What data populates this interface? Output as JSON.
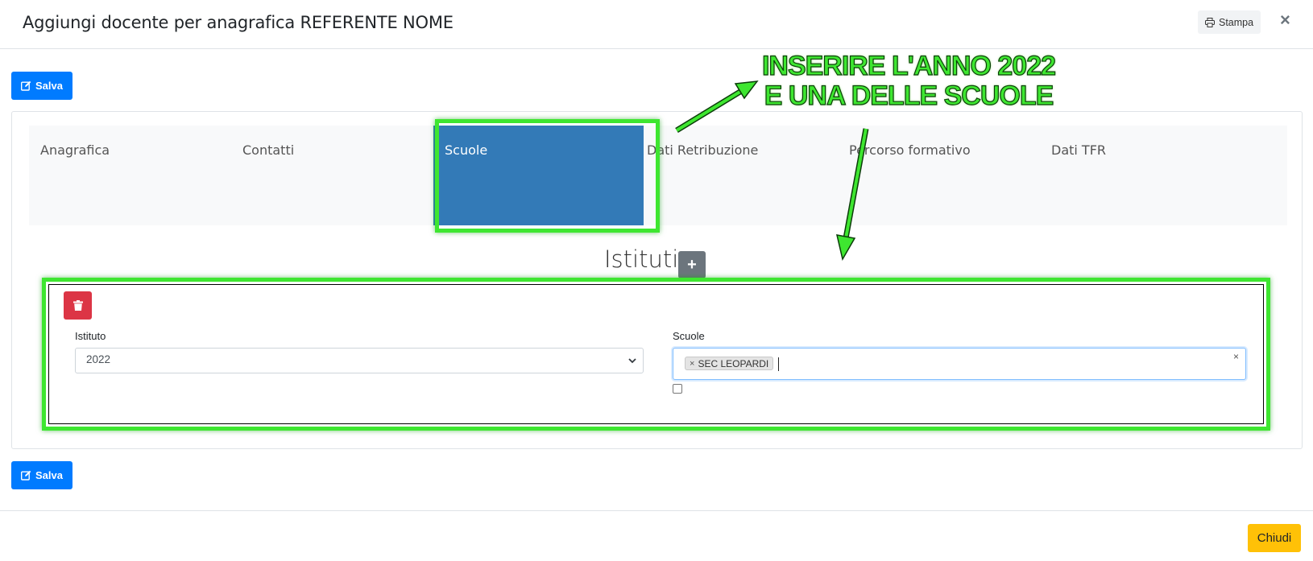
{
  "header": {
    "title": "Aggiungi docente per anagrafica REFERENTE NOME",
    "print_label": "Stampa",
    "close_symbol": "×"
  },
  "toolbar": {
    "save_label": "Salva"
  },
  "tabs": [
    {
      "label": "Anagrafica",
      "active": false
    },
    {
      "label": "Contatti",
      "active": false
    },
    {
      "label": "Scuole",
      "active": true
    },
    {
      "label": "Dati Retribuzione",
      "active": false
    },
    {
      "label": "Percorso formativo",
      "active": false
    },
    {
      "label": "Dati TFR",
      "active": false
    }
  ],
  "section": {
    "title": "Istituti",
    "add_symbol": "+"
  },
  "form": {
    "istituto_label": "Istituto",
    "istituto_value": "2022",
    "scuole_label": "Scuole",
    "scuole_selected": [
      "SEC LEOPARDI"
    ],
    "chip_remove": "×",
    "clear_all": "×",
    "checkbox_checked": false
  },
  "annotation": {
    "line1": "INSERIRE L'ANNO 2022",
    "line2": "E UNA DELLE SCUOLE"
  },
  "footer": {
    "close_label": "Chiudi"
  },
  "colors": {
    "primary": "#007bff",
    "active_tab": "#337ab7",
    "danger": "#dc3545",
    "warning": "#ffc107",
    "secondary": "#6c757d",
    "highlight": "#3ee630"
  },
  "icons": {
    "print": "print-icon",
    "edit": "edit-icon",
    "trash": "trash-icon",
    "caret": "chevron-down-icon"
  }
}
